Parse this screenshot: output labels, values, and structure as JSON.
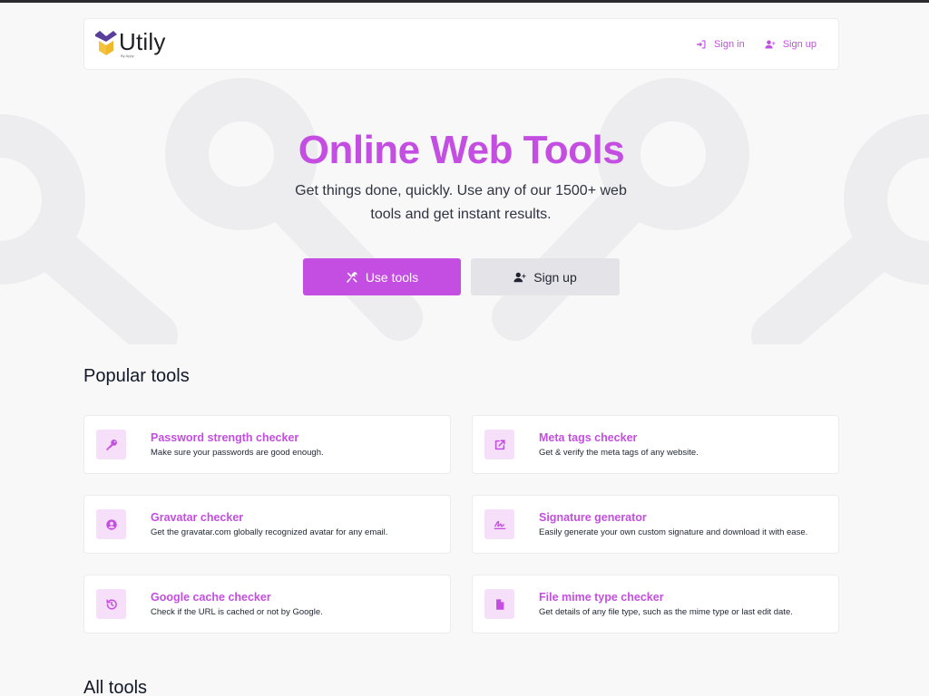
{
  "brand": {
    "name": "Utily",
    "tagline": "By Appy",
    "colors": {
      "accent": "#c44ee2",
      "logo_purple": "#5a3e9c",
      "logo_yellow": "#f3c33b"
    }
  },
  "header": {
    "sign_in": {
      "label": "Sign in",
      "icon": "sign-in-icon"
    },
    "sign_up": {
      "label": "Sign up",
      "icon": "user-plus-icon"
    }
  },
  "hero": {
    "title": "Online Web Tools",
    "subtitle": "Get things done, quickly. Use any of our 1500+ web tools and get instant results.",
    "primary_button": {
      "label": "Use tools",
      "icon": "tools-icon"
    },
    "secondary_button": {
      "label": "Sign up",
      "icon": "user-plus-icon"
    }
  },
  "popular": {
    "title": "Popular tools",
    "tools": [
      {
        "title": "Password strength checker",
        "desc": "Make sure your passwords are good enough.",
        "icon": "key-icon"
      },
      {
        "title": "Meta tags checker",
        "desc": "Get & verify the meta tags of any website.",
        "icon": "external-link-icon"
      },
      {
        "title": "Gravatar checker",
        "desc": "Get the gravatar.com globally recognized avatar for any email.",
        "icon": "user-circle-icon"
      },
      {
        "title": "Signature generator",
        "desc": "Easily generate your own custom signature and download it with ease.",
        "icon": "signature-icon"
      },
      {
        "title": "Google cache checker",
        "desc": "Check if the URL is cached or not by Google.",
        "icon": "history-icon"
      },
      {
        "title": "File mime type checker",
        "desc": "Get details of any file type, such as the mime type or last edit date.",
        "icon": "file-icon"
      }
    ]
  },
  "all_tools": {
    "title": "All tools"
  }
}
